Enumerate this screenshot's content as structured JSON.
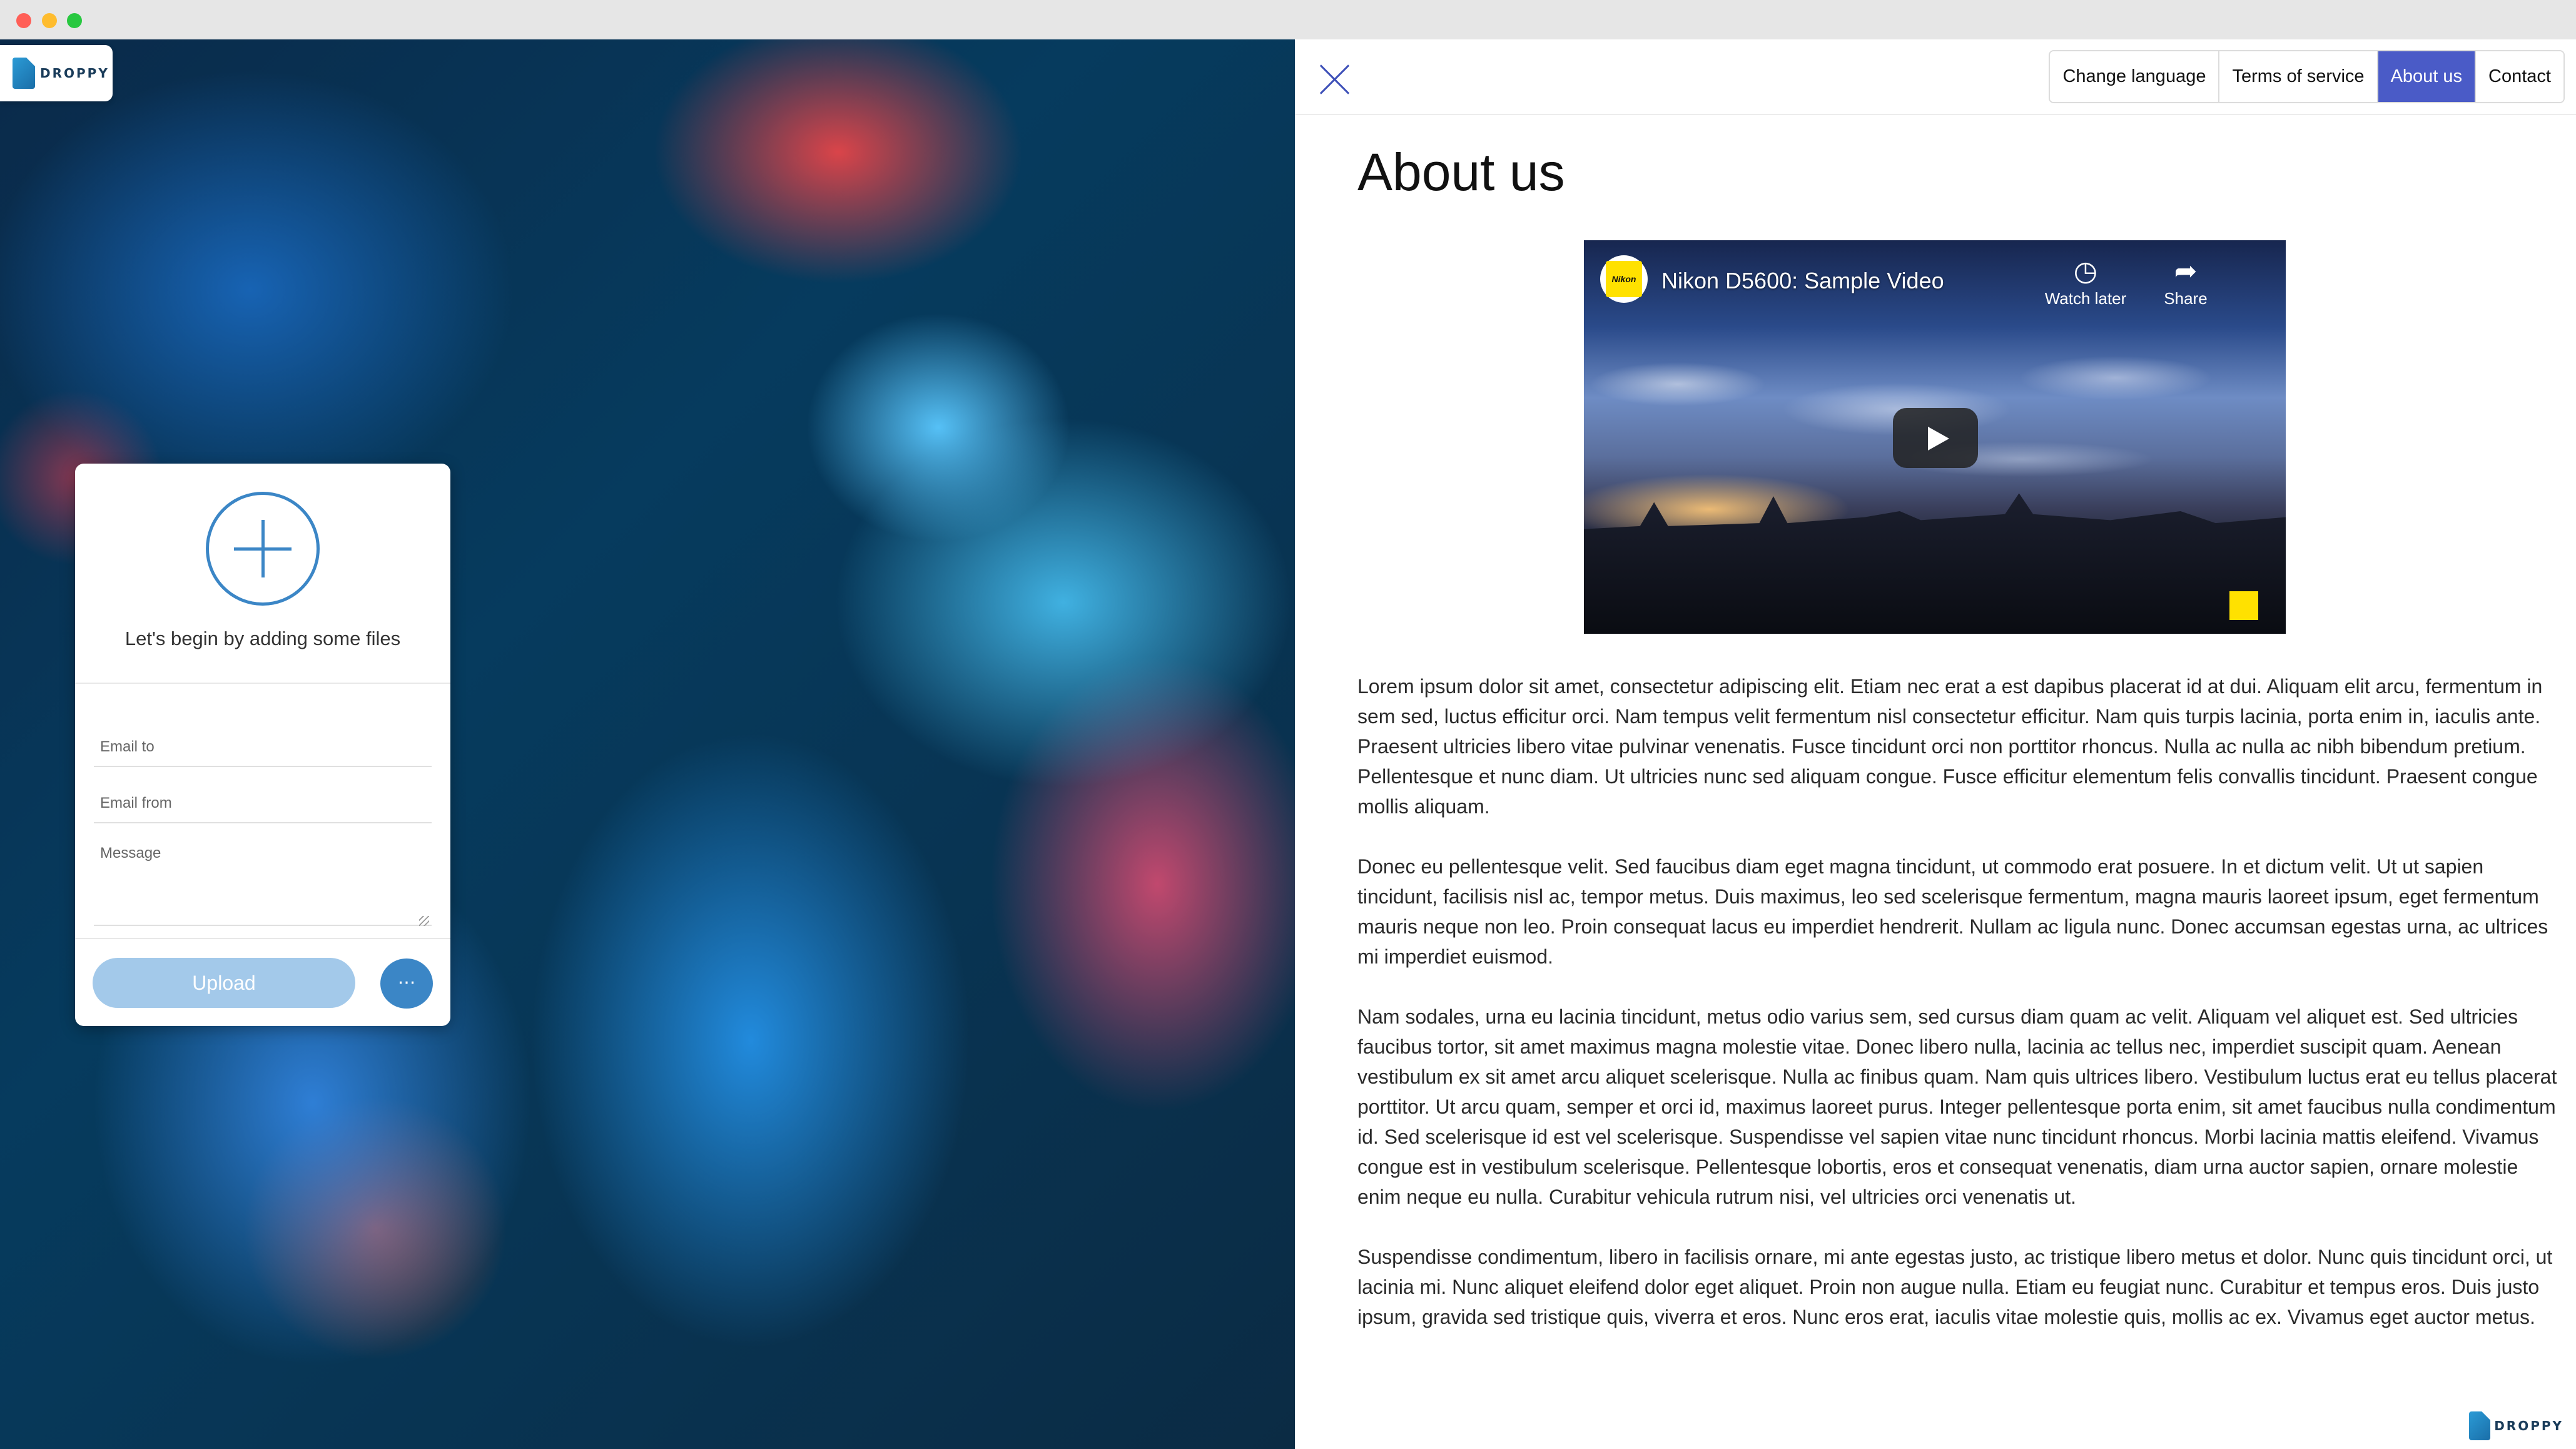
{
  "brand": {
    "logo_text": "DROPPY"
  },
  "upload_card": {
    "prompt": "Let's begin by adding some files",
    "email_to_placeholder": "Email to",
    "email_from_placeholder": "Email from",
    "message_placeholder": "Message",
    "upload_label": "Upload",
    "more_label": "···"
  },
  "nav": {
    "items": [
      {
        "label": "Change language"
      },
      {
        "label": "Terms of service"
      },
      {
        "label": "About us"
      },
      {
        "label": "Contact"
      }
    ],
    "active": "About us"
  },
  "page": {
    "title": "About us"
  },
  "video": {
    "title": "Nikon D5600: Sample Video",
    "channel": "Nikon",
    "watch_later": "Watch later",
    "share": "Share"
  },
  "paragraphs": [
    "Lorem ipsum dolor sit amet, consectetur adipiscing elit. Etiam nec erat a est dapibus placerat id at dui. Aliquam elit arcu, fermentum in sem sed, luctus efficitur orci. Nam tempus velit fermentum nisl consectetur efficitur. Nam quis turpis lacinia, porta enim in, iaculis ante. Praesent ultricies libero vitae pulvinar venenatis. Fusce tincidunt orci non porttitor rhoncus. Nulla ac nulla ac nibh bibendum pretium. Pellentesque et nunc diam. Ut ultricies nunc sed aliquam congue. Fusce efficitur elementum felis convallis tincidunt. Praesent congue mollis aliquam.",
    "Donec eu pellentesque velit. Sed faucibus diam eget magna tincidunt, ut commodo erat posuere. In et dictum velit. Ut ut sapien tincidunt, facilisis nisl ac, tempor metus. Duis maximus, leo sed scelerisque fermentum, magna mauris laoreet ipsum, eget fermentum mauris neque non leo. Proin consequat lacus eu imperdiet hendrerit. Nullam ac ligula nunc. Donec accumsan egestas urna, ac ultrices mi imperdiet euismod.",
    "Nam sodales, urna eu lacinia tincidunt, metus odio varius sem, sed cursus diam quam ac velit. Aliquam vel aliquet est. Sed ultricies faucibus tortor, sit amet maximus magna molestie vitae. Donec libero nulla, lacinia ac tellus nec, imperdiet suscipit quam. Aenean vestibulum ex sit amet arcu aliquet scelerisque. Nulla ac finibus quam. Nam quis ultrices libero. Vestibulum luctus erat eu tellus placerat porttitor. Ut arcu quam, semper et orci id, maximus laoreet purus. Integer pellentesque porta enim, sit amet faucibus nulla condimentum id. Sed scelerisque id est vel scelerisque. Suspendisse vel sapien vitae nunc tincidunt rhoncus. Morbi lacinia mattis eleifend. Vivamus congue est in vestibulum scelerisque. Pellentesque lobortis, eros et consequat venenatis, diam urna auctor sapien, ornare molestie enim neque eu nulla. Curabitur vehicula rutrum nisi, vel ultricies orci venenatis ut.",
    "Suspendisse condimentum, libero in facilisis ornare, mi ante egestas justo, ac tristique libero metus et dolor. Nunc quis tincidunt orci, ut lacinia mi. Nunc aliquet eleifend dolor eget aliquet. Proin non augue nulla. Etiam eu feugiat nunc. Curabitur et tempus eros. Duis justo ipsum, gravida sed tristique quis, viverra et eros. Nunc eros erat, iaculis vitae molestie quis, mollis ac ex. Vivamus eget auctor metus."
  ],
  "colors": {
    "accent": "#4a5bc7",
    "upload_button": "#a3c9ea",
    "card_accent": "#3b86c6"
  }
}
